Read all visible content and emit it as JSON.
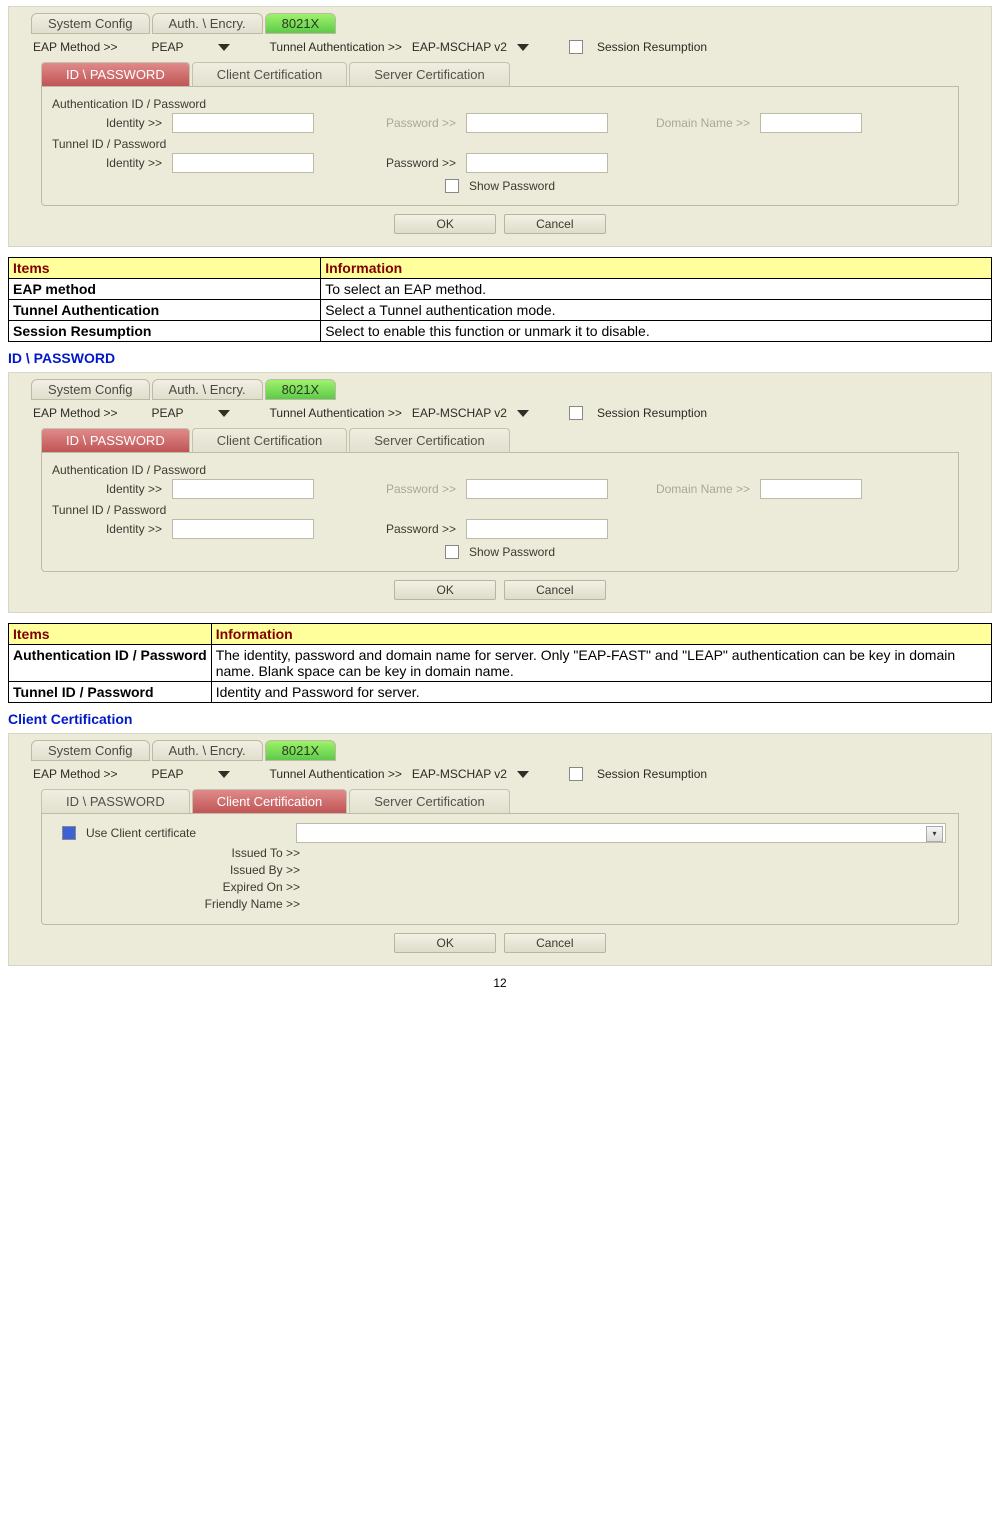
{
  "tabs": {
    "sys": "System Config",
    "auth": "Auth. \\ Encry.",
    "x": "8021X"
  },
  "opts": {
    "eap_label": "EAP Method >>",
    "eap_value": "PEAP",
    "tun_label": "Tunnel Authentication >>",
    "tun_value": "EAP-MSCHAP v2",
    "sess": "Session Resumption"
  },
  "subtabs": {
    "id": "ID \\ PASSWORD",
    "cli": "Client Certification",
    "srv": "Server Certification"
  },
  "grp1": "Authentication ID / Password",
  "grp2": "Tunnel ID / Password",
  "lab": {
    "identity": "Identity >>",
    "password": "Password >>",
    "domain": "Domain Name >>",
    "show": "Show Password"
  },
  "btn": {
    "ok": "OK",
    "cancel": "Cancel"
  },
  "table1": {
    "h1": "Items",
    "h2": "Information",
    "r": [
      [
        "EAP method",
        "To select an EAP method."
      ],
      [
        "Tunnel Authentication",
        "Select a Tunnel authentication mode."
      ],
      [
        "Session Resumption",
        "Select to enable this function or unmark it to disable."
      ]
    ]
  },
  "sec2": "ID \\ PASSWORD",
  "table2": {
    "h1": "Items",
    "h2": "Information",
    "r": [
      [
        "Authentication ID / Password",
        "The identity, password and domain name for server. Only \"EAP-FAST\" and \"LEAP\" authentication can be key in domain name. Blank space can be key in domain name."
      ],
      [
        "Tunnel ID / Password",
        "Identity and Password for server."
      ]
    ]
  },
  "sec3": "Client Certification",
  "cli": {
    "use": "Use Client certificate",
    "issued_to": "Issued To >>",
    "issued_by": "Issued By >>",
    "expired": "Expired On >>",
    "friendly": "Friendly Name >>"
  },
  "page": "12"
}
